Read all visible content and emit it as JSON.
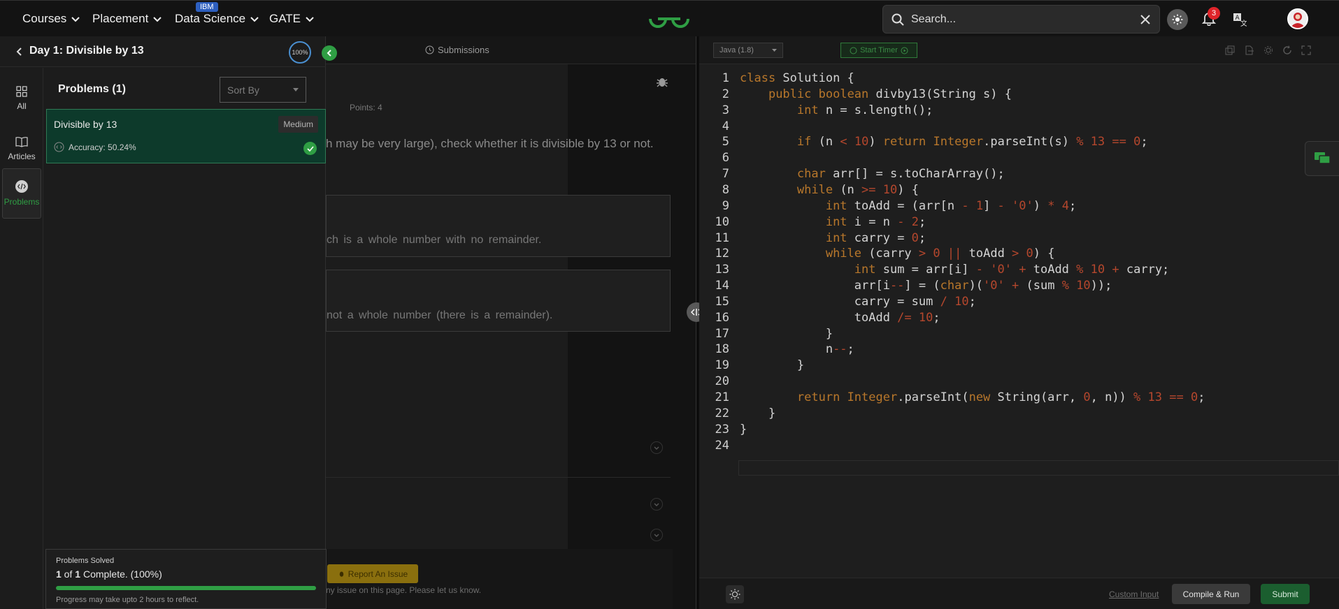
{
  "nav": {
    "courses": "Courses",
    "placement": "Placement",
    "data_science": "Data Science",
    "ibm_badge": "IBM",
    "gate": "GATE"
  },
  "search": {
    "placeholder": "Search..."
  },
  "notifications": {
    "count": "3"
  },
  "colors": {
    "accent": "#2f9e44",
    "badge": "#e0242a",
    "ibm": "#2d5fbf",
    "report": "#8a6f0e"
  },
  "drawer": {
    "title": "Day 1: Divisible by 13",
    "progress": "100%",
    "rail": [
      {
        "label": "All",
        "icon": "grid-icon"
      },
      {
        "label": "Articles",
        "icon": "book-icon"
      },
      {
        "label": "Problems",
        "icon": "code-icon"
      }
    ],
    "problems_heading": "Problems (1)",
    "sort_by": "Sort By",
    "problem": {
      "name": "Divisible by 13",
      "difficulty": "Medium",
      "accuracy": "Accuracy: 50.24%"
    },
    "solved": {
      "label": "Problems Solved",
      "count_bold": "1",
      "count_rest": " of ",
      "count_total": "1",
      "count_suffix": " Complete. (100%)",
      "progress_fraction": 1.0,
      "note": "Progress may take upto 2 hours to reflect."
    }
  },
  "problem_view": {
    "submissions_tab": "Submissions",
    "points": "Points: 4",
    "statement_fragment": "h may be very large), check whether it is divisible by 13 or not.",
    "example1_fragment": "ch is a whole number with no remainder.",
    "example2_fragment": "not a whole number (there is a remainder).",
    "report_button": "Report An Issue",
    "report_text": "ny issue on this page. Please let us know."
  },
  "editor": {
    "language": "Java (1.8)",
    "timer": "Start Timer",
    "custom_input": "Custom Input",
    "compile_run": "Compile & Run",
    "submit": "Submit",
    "lines": [
      "class Solution {",
      "    public boolean divby13(String s) {",
      "        int n = s.length();",
      "",
      "        if (n < 10) return Integer.parseInt(s) % 13 == 0;",
      "",
      "        char arr[] = s.toCharArray();",
      "        while (n >= 10) {",
      "            int toAdd = (arr[n - 1] - '0') * 4;",
      "            int i = n - 2;",
      "            int carry = 0;",
      "            while (carry > 0 || toAdd > 0) {",
      "                int sum = arr[i] - '0' + toAdd % 10 + carry;",
      "                arr[i--] = (char)('0' + (sum % 10));",
      "                carry = sum / 10;",
      "                toAdd /= 10;",
      "            }",
      "            n--;",
      "        }",
      "",
      "        return Integer.parseInt(new String(arr, 0, n)) % 13 == 0;",
      "    }",
      "}",
      ""
    ]
  }
}
